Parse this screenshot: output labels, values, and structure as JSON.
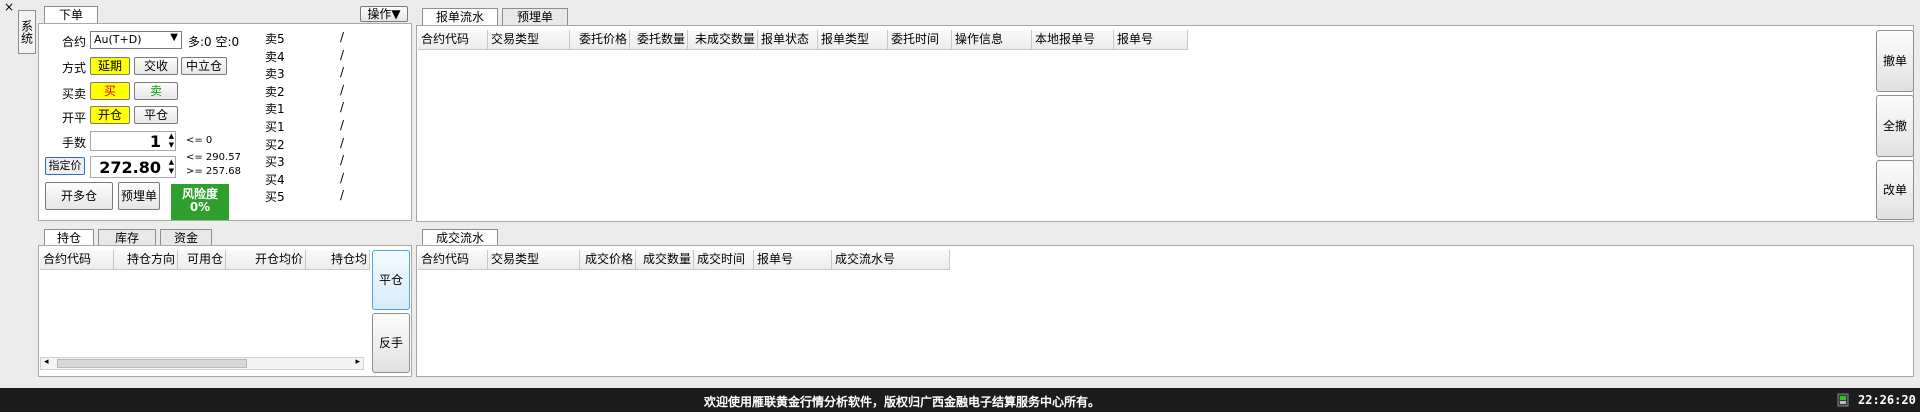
{
  "window": {
    "close": "×",
    "sys_tab": "系统"
  },
  "order_panel": {
    "tab": "下单",
    "ops": "操作▼",
    "contract_label": "合约",
    "contract_value": "Au(T+D)",
    "long_short": "多:0 空:0",
    "mode_label": "方式",
    "mode_btns": [
      "延期",
      "交收",
      "中立仓"
    ],
    "side_label": "买卖",
    "buy": "买",
    "sell": "卖",
    "oc_label": "开平",
    "open": "开仓",
    "close": "平仓",
    "qty_label": "手数",
    "qty": "1",
    "qty_limit": "<= 0",
    "price_btn": "指定价",
    "price": "272.80",
    "price_hi": "<= 290.57",
    "price_lo": ">= 257.68",
    "open_long": "开多仓",
    "pre_order": "预埋单",
    "risk": "风险度",
    "risk_val": "0%"
  },
  "depth": {
    "rows": [
      {
        "label": "卖5",
        "val": "/"
      },
      {
        "label": "卖4",
        "val": "/"
      },
      {
        "label": "卖3",
        "val": "/"
      },
      {
        "label": "卖2",
        "val": "/"
      },
      {
        "label": "卖1",
        "val": "/"
      },
      {
        "label": "买1",
        "val": "/"
      },
      {
        "label": "买2",
        "val": "/"
      },
      {
        "label": "买3",
        "val": "/"
      },
      {
        "label": "买4",
        "val": "/"
      },
      {
        "label": "买5",
        "val": "/"
      }
    ]
  },
  "orders": {
    "tabs": [
      "报单流水",
      "预埋单"
    ],
    "columns": [
      "合约代码",
      "交易类型",
      "委托价格",
      "委托数量",
      "未成交数量",
      "报单状态",
      "报单类型",
      "委托时间",
      "操作信息",
      "本地报单号",
      "报单号"
    ],
    "side_btns": [
      "撤单",
      "全撤",
      "改单"
    ]
  },
  "positions": {
    "tabs": [
      "持仓",
      "库存",
      "资金"
    ],
    "columns": [
      "合约代码",
      "持仓方向",
      "可用仓",
      "开仓均价",
      "持仓均"
    ],
    "side_btns": [
      "平仓",
      "反手"
    ]
  },
  "trades": {
    "tab": "成交流水",
    "columns": [
      "合约代码",
      "交易类型",
      "成交价格",
      "成交数量",
      "成交时间",
      "报单号",
      "成交流水号"
    ]
  },
  "status": {
    "message": "欢迎使用雁联黄金行情分析软件，版权归广西金融电子结算服务中心所有。",
    "time": "22:26:20"
  }
}
